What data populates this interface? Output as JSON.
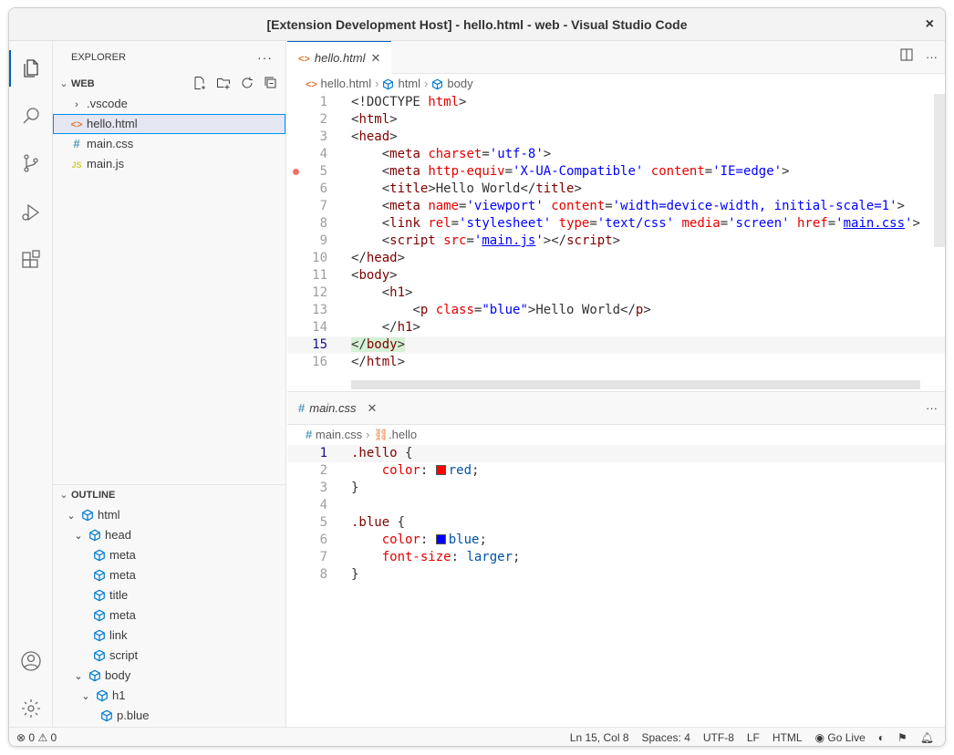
{
  "window": {
    "title": "[Extension Development Host] - hello.html - web - Visual Studio Code",
    "close": "×"
  },
  "sidebar": {
    "header": "EXPLORER",
    "more": "···",
    "workspace": "WEB",
    "files": [
      {
        "label": ".vscode",
        "kind": "folder"
      },
      {
        "label": "hello.html",
        "kind": "html"
      },
      {
        "label": "main.css",
        "kind": "css"
      },
      {
        "label": "main.js",
        "kind": "js"
      }
    ],
    "outline_header": "OUTLINE",
    "outline": [
      {
        "label": "html",
        "depth": 1,
        "chevron": true
      },
      {
        "label": "head",
        "depth": 2,
        "chevron": true
      },
      {
        "label": "meta",
        "depth": 3,
        "chevron": false
      },
      {
        "label": "meta",
        "depth": 3,
        "chevron": false
      },
      {
        "label": "title",
        "depth": 3,
        "chevron": false
      },
      {
        "label": "meta",
        "depth": 3,
        "chevron": false
      },
      {
        "label": "link",
        "depth": 3,
        "chevron": false
      },
      {
        "label": "script",
        "depth": 3,
        "chevron": false
      },
      {
        "label": "body",
        "depth": 2,
        "chevron": true
      },
      {
        "label": "h1",
        "depth": 3,
        "chevron": true
      },
      {
        "label": "p.blue",
        "depth": 4,
        "chevron": false
      }
    ]
  },
  "editor1": {
    "tab": "hello.html",
    "tab_close": "✕",
    "breadcrumb": [
      "hello.html",
      "html",
      "body"
    ],
    "current_line": 15,
    "breakpoint_line": 5
  },
  "editor2": {
    "tab": "main.css",
    "tab_close": "✕",
    "breadcrumb": [
      "main.css",
      ".hello"
    ],
    "current_line": 1
  },
  "status": {
    "errors": "0",
    "warnings": "0",
    "position": "Ln 15, Col 8",
    "spaces": "Spaces: 4",
    "encoding": "UTF-8",
    "eol": "LF",
    "language": "HTML",
    "golive": "Go Live"
  },
  "colors": {
    "accent": "#005fb8",
    "red_swatch": "#ff0000",
    "blue_swatch": "#0000ff"
  }
}
